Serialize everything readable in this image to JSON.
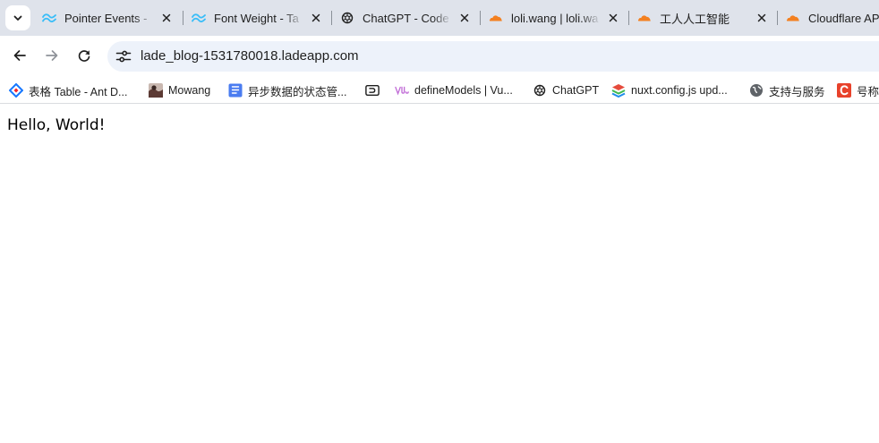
{
  "tabs": [
    {
      "title": "Pointer Events -",
      "icon": "tailwind-icon"
    },
    {
      "title": "Font Weight - Ta",
      "icon": "tailwind-icon"
    },
    {
      "title": "ChatGPT - Code",
      "icon": "openai-icon"
    },
    {
      "title": "loli.wang | loli.wa",
      "icon": "cloudflare-icon"
    },
    {
      "title": "工人人工智能",
      "icon": "cloudflare-icon"
    },
    {
      "title": "Cloudflare AP",
      "icon": "cloudflare-icon"
    }
  ],
  "address_bar": {
    "url": "lade_blog-1531780018.ladeapp.com"
  },
  "bookmarks": [
    {
      "label": "表格 Table - Ant D...",
      "icon": "antd-icon"
    },
    {
      "label": "Mowang",
      "icon": "avatar-icon"
    },
    {
      "label": "异步数据的状态管...",
      "icon": "doc-icon"
    },
    {
      "label": "",
      "icon": "terminal-icon"
    },
    {
      "label": "defineModels | Vu...",
      "icon": "vueuse-icon"
    },
    {
      "label": "ChatGPT",
      "icon": "openai-icon"
    },
    {
      "label": "nuxt.config.js upd...",
      "icon": "layers-icon"
    },
    {
      "label": "支持与服务",
      "icon": "globe-icon"
    },
    {
      "label": "号称",
      "icon": "c-logo-icon"
    }
  ],
  "page": {
    "text": "Hello, World!"
  },
  "colors": {
    "tabstrip_bg": "#dfe3eb",
    "omnibox_bg": "#edf2fa",
    "tailwind": "#38bdf8",
    "cloudflare": "#f38020",
    "antd_blue": "#1677ff",
    "c_logo": "#e8422b"
  }
}
